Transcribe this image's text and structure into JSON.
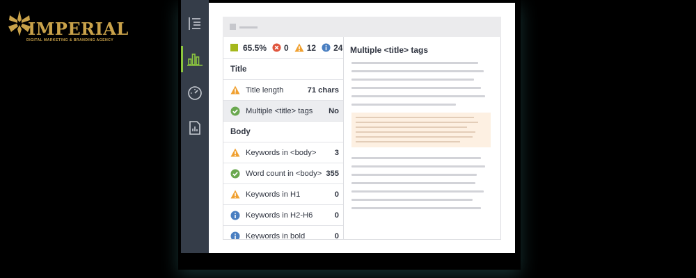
{
  "brand": {
    "name": "IMPERIAL",
    "tagline": "DIGITAL MARKETING & BRANDING AGENCY",
    "color": "#c9a24a"
  },
  "sidebar": {
    "items": [
      {
        "icon": "list-outline-icon",
        "active": false
      },
      {
        "icon": "bar-chart-icon",
        "active": true
      },
      {
        "icon": "speedometer-icon",
        "active": false
      },
      {
        "icon": "report-document-icon",
        "active": false
      }
    ],
    "active_color": "#8cc63f"
  },
  "summary": {
    "score": "65.5%",
    "errors": "0",
    "warnings": "12",
    "info": "24"
  },
  "checks": {
    "title_section": "Title",
    "body_section": "Body",
    "title_length": {
      "label": "Title length",
      "value": "71 chars",
      "status": "warning"
    },
    "multiple_title": {
      "label": "Multiple <title> tags",
      "value": "No",
      "status": "ok"
    },
    "keywords_body": {
      "label": "Keywords in <body>",
      "value": "3",
      "status": "warning"
    },
    "word_count": {
      "label": "Word count in <body>",
      "value": "355",
      "status": "ok"
    },
    "keywords_h1": {
      "label": "Keywords in H1",
      "value": "0",
      "status": "warning"
    },
    "keywords_h2h6": {
      "label": "Keywords in H2-H6",
      "value": "0",
      "status": "info"
    },
    "keywords_bold": {
      "label": "Keywords in bold",
      "value": "0",
      "status": "info"
    }
  },
  "detail": {
    "title": "Multiple <title> tags"
  },
  "colors": {
    "ok": "#6aa84f",
    "warning": "#f0a030",
    "error": "#e0553d",
    "info": "#4a7fc1"
  }
}
